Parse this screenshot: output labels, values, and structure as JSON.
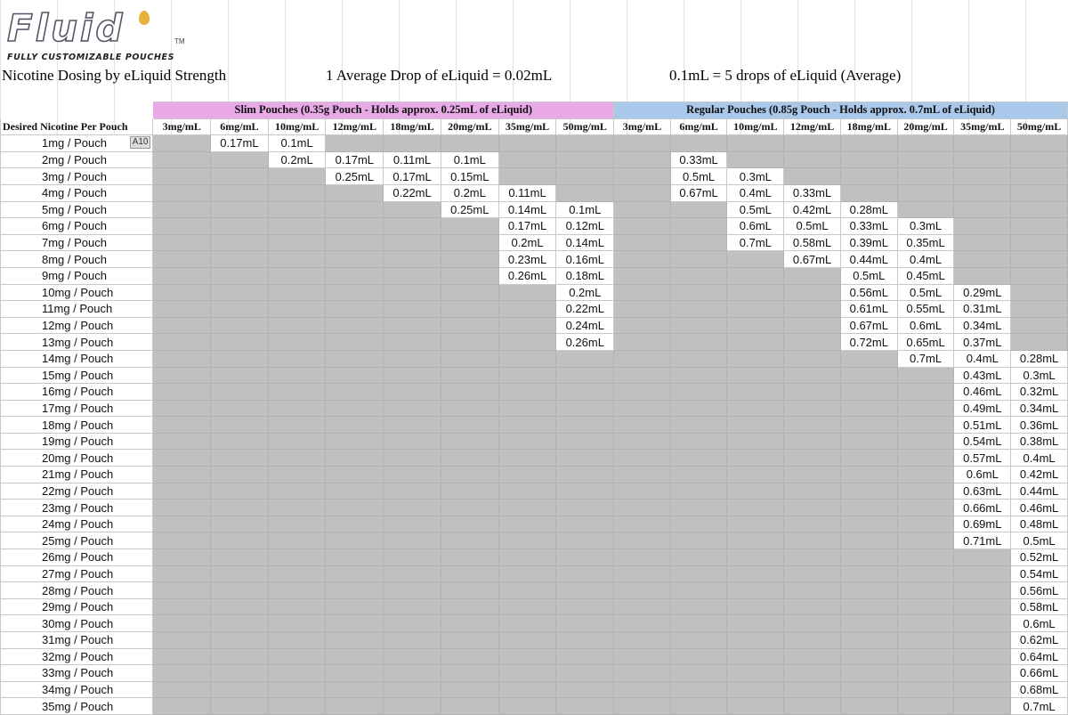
{
  "logo": {
    "word": "Fluid",
    "tm": "TM",
    "tagline": "FULLY CUSTOMIZABLE POUCHES"
  },
  "titles": {
    "main": "Nicotine Dosing by eLiquid Strength",
    "drop": "1 Average Drop of eLiquid = 0.02mL",
    "conversion": "0.1mL = 5 drops of eLiquid (Average)"
  },
  "groups": {
    "slim": "Slim Pouches (0.35g Pouch - Holds approx. 0.25mL of eLiquid)",
    "regular": "Regular Pouches (0.85g Pouch - Holds approx. 0.7mL of eLiquid)"
  },
  "row_header": "Desired Nicotine Per Pouch",
  "cell_ref": "A10",
  "columns": [
    "3mg/mL",
    "6mg/mL",
    "10mg/mL",
    "12mg/mL",
    "18mg/mL",
    "20mg/mL",
    "35mg/mL",
    "50mg/mL",
    "3mg/mL",
    "6mg/mL",
    "10mg/mL",
    "12mg/mL",
    "18mg/mL",
    "20mg/mL",
    "35mg/mL",
    "50mg/mL"
  ],
  "rows": [
    {
      "label": "1mg / Pouch",
      "cells": [
        "",
        "0.17mL",
        "0.1mL",
        "",
        "",
        "",
        "",
        "",
        "",
        "",
        "",
        "",
        "",
        "",
        "",
        ""
      ]
    },
    {
      "label": "2mg / Pouch",
      "cells": [
        "",
        "",
        "0.2mL",
        "0.17mL",
        "0.11mL",
        "0.1mL",
        "",
        "",
        "",
        "0.33mL",
        "",
        "",
        "",
        "",
        "",
        ""
      ]
    },
    {
      "label": "3mg / Pouch",
      "cells": [
        "",
        "",
        "",
        "0.25mL",
        "0.17mL",
        "0.15mL",
        "",
        "",
        "",
        "0.5mL",
        "0.3mL",
        "",
        "",
        "",
        "",
        ""
      ]
    },
    {
      "label": "4mg / Pouch",
      "cells": [
        "",
        "",
        "",
        "",
        "0.22mL",
        "0.2mL",
        "0.11mL",
        "",
        "",
        "0.67mL",
        "0.4mL",
        "0.33mL",
        "",
        "",
        "",
        ""
      ]
    },
    {
      "label": "5mg / Pouch",
      "cells": [
        "",
        "",
        "",
        "",
        "",
        "0.25mL",
        "0.14mL",
        "0.1mL",
        "",
        "",
        "0.5mL",
        "0.42mL",
        "0.28mL",
        "",
        "",
        ""
      ]
    },
    {
      "label": "6mg / Pouch",
      "cells": [
        "",
        "",
        "",
        "",
        "",
        "",
        "0.17mL",
        "0.12mL",
        "",
        "",
        "0.6mL",
        "0.5mL",
        "0.33mL",
        "0.3mL",
        "",
        ""
      ]
    },
    {
      "label": "7mg / Pouch",
      "cells": [
        "",
        "",
        "",
        "",
        "",
        "",
        "0.2mL",
        "0.14mL",
        "",
        "",
        "0.7mL",
        "0.58mL",
        "0.39mL",
        "0.35mL",
        "",
        ""
      ]
    },
    {
      "label": "8mg / Pouch",
      "cells": [
        "",
        "",
        "",
        "",
        "",
        "",
        "0.23mL",
        "0.16mL",
        "",
        "",
        "",
        "0.67mL",
        "0.44mL",
        "0.4mL",
        "",
        ""
      ]
    },
    {
      "label": "9mg / Pouch",
      "cells": [
        "",
        "",
        "",
        "",
        "",
        "",
        "0.26mL",
        "0.18mL",
        "",
        "",
        "",
        "",
        "0.5mL",
        "0.45mL",
        "",
        ""
      ]
    },
    {
      "label": "10mg / Pouch",
      "cells": [
        "",
        "",
        "",
        "",
        "",
        "",
        "",
        "0.2mL",
        "",
        "",
        "",
        "",
        "0.56mL",
        "0.5mL",
        "0.29mL",
        ""
      ]
    },
    {
      "label": "11mg / Pouch",
      "cells": [
        "",
        "",
        "",
        "",
        "",
        "",
        "",
        "0.22mL",
        "",
        "",
        "",
        "",
        "0.61mL",
        "0.55mL",
        "0.31mL",
        ""
      ]
    },
    {
      "label": "12mg / Pouch",
      "cells": [
        "",
        "",
        "",
        "",
        "",
        "",
        "",
        "0.24mL",
        "",
        "",
        "",
        "",
        "0.67mL",
        "0.6mL",
        "0.34mL",
        ""
      ]
    },
    {
      "label": "13mg / Pouch",
      "cells": [
        "",
        "",
        "",
        "",
        "",
        "",
        "",
        "0.26mL",
        "",
        "",
        "",
        "",
        "0.72mL",
        "0.65mL",
        "0.37mL",
        ""
      ]
    },
    {
      "label": "14mg / Pouch",
      "cells": [
        "",
        "",
        "",
        "",
        "",
        "",
        "",
        "",
        "",
        "",
        "",
        "",
        "",
        "0.7mL",
        "0.4mL",
        "0.28mL"
      ]
    },
    {
      "label": "15mg / Pouch",
      "cells": [
        "",
        "",
        "",
        "",
        "",
        "",
        "",
        "",
        "",
        "",
        "",
        "",
        "",
        "",
        "0.43mL",
        "0.3mL"
      ]
    },
    {
      "label": "16mg / Pouch",
      "cells": [
        "",
        "",
        "",
        "",
        "",
        "",
        "",
        "",
        "",
        "",
        "",
        "",
        "",
        "",
        "0.46mL",
        "0.32mL"
      ]
    },
    {
      "label": "17mg / Pouch",
      "cells": [
        "",
        "",
        "",
        "",
        "",
        "",
        "",
        "",
        "",
        "",
        "",
        "",
        "",
        "",
        "0.49mL",
        "0.34mL"
      ]
    },
    {
      "label": "18mg / Pouch",
      "cells": [
        "",
        "",
        "",
        "",
        "",
        "",
        "",
        "",
        "",
        "",
        "",
        "",
        "",
        "",
        "0.51mL",
        "0.36mL"
      ]
    },
    {
      "label": "19mg / Pouch",
      "cells": [
        "",
        "",
        "",
        "",
        "",
        "",
        "",
        "",
        "",
        "",
        "",
        "",
        "",
        "",
        "0.54mL",
        "0.38mL"
      ]
    },
    {
      "label": "20mg / Pouch",
      "cells": [
        "",
        "",
        "",
        "",
        "",
        "",
        "",
        "",
        "",
        "",
        "",
        "",
        "",
        "",
        "0.57mL",
        "0.4mL"
      ]
    },
    {
      "label": "21mg / Pouch",
      "cells": [
        "",
        "",
        "",
        "",
        "",
        "",
        "",
        "",
        "",
        "",
        "",
        "",
        "",
        "",
        "0.6mL",
        "0.42mL"
      ]
    },
    {
      "label": "22mg / Pouch",
      "cells": [
        "",
        "",
        "",
        "",
        "",
        "",
        "",
        "",
        "",
        "",
        "",
        "",
        "",
        "",
        "0.63mL",
        "0.44mL"
      ]
    },
    {
      "label": "23mg / Pouch",
      "cells": [
        "",
        "",
        "",
        "",
        "",
        "",
        "",
        "",
        "",
        "",
        "",
        "",
        "",
        "",
        "0.66mL",
        "0.46mL"
      ]
    },
    {
      "label": "24mg / Pouch",
      "cells": [
        "",
        "",
        "",
        "",
        "",
        "",
        "",
        "",
        "",
        "",
        "",
        "",
        "",
        "",
        "0.69mL",
        "0.48mL"
      ]
    },
    {
      "label": "25mg / Pouch",
      "cells": [
        "",
        "",
        "",
        "",
        "",
        "",
        "",
        "",
        "",
        "",
        "",
        "",
        "",
        "",
        "0.71mL",
        "0.5mL"
      ]
    },
    {
      "label": "26mg / Pouch",
      "cells": [
        "",
        "",
        "",
        "",
        "",
        "",
        "",
        "",
        "",
        "",
        "",
        "",
        "",
        "",
        "",
        "0.52mL"
      ]
    },
    {
      "label": "27mg / Pouch",
      "cells": [
        "",
        "",
        "",
        "",
        "",
        "",
        "",
        "",
        "",
        "",
        "",
        "",
        "",
        "",
        "",
        "0.54mL"
      ]
    },
    {
      "label": "28mg / Pouch",
      "cells": [
        "",
        "",
        "",
        "",
        "",
        "",
        "",
        "",
        "",
        "",
        "",
        "",
        "",
        "",
        "",
        "0.56mL"
      ]
    },
    {
      "label": "29mg / Pouch",
      "cells": [
        "",
        "",
        "",
        "",
        "",
        "",
        "",
        "",
        "",
        "",
        "",
        "",
        "",
        "",
        "",
        "0.58mL"
      ]
    },
    {
      "label": "30mg / Pouch",
      "cells": [
        "",
        "",
        "",
        "",
        "",
        "",
        "",
        "",
        "",
        "",
        "",
        "",
        "",
        "",
        "",
        "0.6mL"
      ]
    },
    {
      "label": "31mg / Pouch",
      "cells": [
        "",
        "",
        "",
        "",
        "",
        "",
        "",
        "",
        "",
        "",
        "",
        "",
        "",
        "",
        "",
        "0.62mL"
      ]
    },
    {
      "label": "32mg / Pouch",
      "cells": [
        "",
        "",
        "",
        "",
        "",
        "",
        "",
        "",
        "",
        "",
        "",
        "",
        "",
        "",
        "",
        "0.64mL"
      ]
    },
    {
      "label": "33mg / Pouch",
      "cells": [
        "",
        "",
        "",
        "",
        "",
        "",
        "",
        "",
        "",
        "",
        "",
        "",
        "",
        "",
        "",
        "0.66mL"
      ]
    },
    {
      "label": "34mg / Pouch",
      "cells": [
        "",
        "",
        "",
        "",
        "",
        "",
        "",
        "",
        "",
        "",
        "",
        "",
        "",
        "",
        "",
        "0.68mL"
      ]
    },
    {
      "label": "35mg / Pouch",
      "cells": [
        "",
        "",
        "",
        "",
        "",
        "",
        "",
        "",
        "",
        "",
        "",
        "",
        "",
        "",
        "",
        "0.7mL"
      ]
    }
  ],
  "colors": {
    "slim_header": "#e8a9e6",
    "regular_header": "#a9c8ea",
    "empty_cell": "#c0c0c0"
  }
}
